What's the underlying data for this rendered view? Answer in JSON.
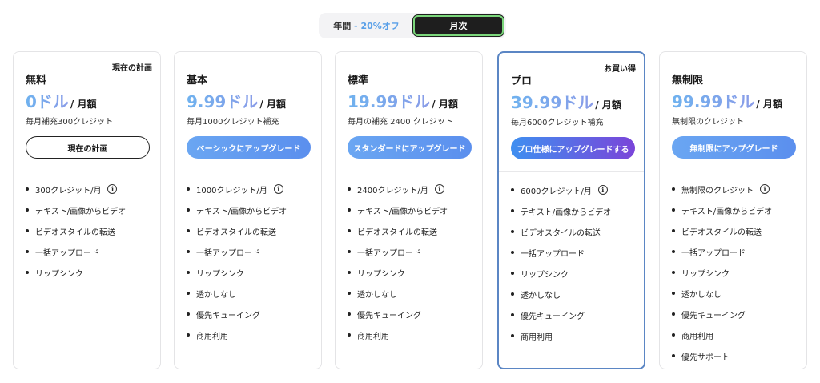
{
  "billing_toggle": {
    "annual_label": "年間",
    "annual_sep": " - ",
    "annual_discount": "20%オフ",
    "monthly_label": "月次",
    "selected": "monthly"
  },
  "plans": [
    {
      "corner_badge": "現在の計画",
      "name": "無料",
      "price": "0ドル",
      "period": "/ 月額",
      "credits": "毎月補充300クレジット",
      "cta": "現在の計画",
      "features": [
        "300クレジット/月",
        "テキスト/画像からビデオ",
        "ビデオスタイルの転送",
        "一括アップロード",
        "リップシンク"
      ]
    },
    {
      "name": "基本",
      "price": "9.99ドル",
      "period": "/ 月額",
      "credits": "毎月1000クレジット補充",
      "cta": "ベーシックにアップグレード",
      "features": [
        "1000クレジット/月",
        "テキスト/画像からビデオ",
        "ビデオスタイルの転送",
        "一括アップロード",
        "リップシンク",
        "透かしなし",
        "優先キューイング",
        "商用利用"
      ]
    },
    {
      "name": "標準",
      "price": "19.99ドル",
      "period": "/ 月額",
      "credits": "毎月の補充 2400 クレジット",
      "cta": "スタンダードにアップグレード",
      "features": [
        "2400クレジット/月",
        "テキスト/画像からビデオ",
        "ビデオスタイルの転送",
        "一括アップロード",
        "リップシンク",
        "透かしなし",
        "優先キューイング",
        "商用利用"
      ]
    },
    {
      "corner_badge": "お買い得",
      "name": "プロ",
      "price": "39.99ドル",
      "period": "/ 月額",
      "credits": "毎月6000クレジット補充",
      "cta": "プロ仕様にアップグレードする",
      "features": [
        "6000クレジット/月",
        "テキスト/画像からビデオ",
        "ビデオスタイルの転送",
        "一括アップロード",
        "リップシンク",
        "透かしなし",
        "優先キューイング",
        "商用利用"
      ]
    },
    {
      "name": "無制限",
      "price": "99.99ドル",
      "period": "/ 月額",
      "credits": "無制限のクレジット",
      "cta": "無制限にアップグレード",
      "features": [
        "無制限のクレジット",
        "テキスト/画像からビデオ",
        "ビデオスタイルの転送",
        "一括アップロード",
        "リップシンク",
        "透かしなし",
        "優先キューイング",
        "商用利用",
        "優先サポート"
      ]
    }
  ],
  "icons": {
    "info": "info-icon",
    "info_glyph": "i"
  },
  "colors": {
    "accent": "#5b8fee",
    "featured_border": "#5b86c4",
    "toggle_selected_bg": "#1e1e1e"
  }
}
